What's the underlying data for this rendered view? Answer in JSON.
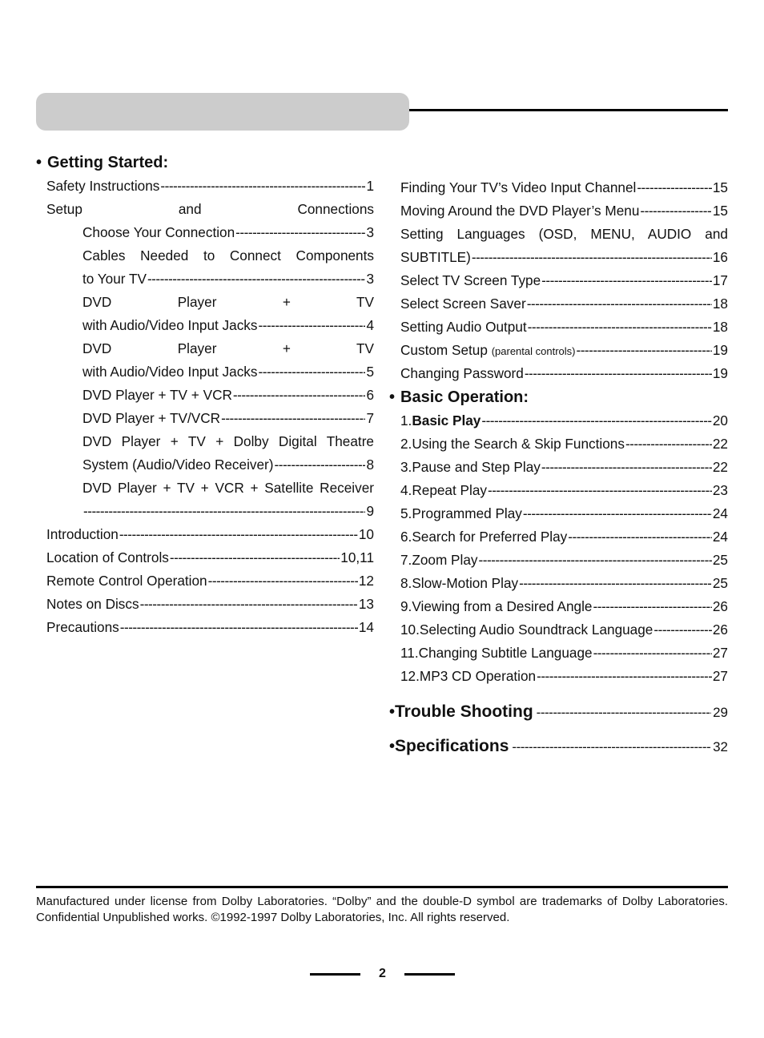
{
  "header": {
    "banner_colors": {
      "box": "#cccccc",
      "rule": "#000000"
    }
  },
  "left_column": {
    "section_title": "Getting Started:",
    "entries": [
      {
        "label": "Safety Instructions",
        "page": "1",
        "level": 0
      },
      {
        "label": "Setup and Connections",
        "page": "",
        "level": 0
      },
      {
        "label": "Choose  Your  Connection",
        "page": "3",
        "level": 1
      },
      {
        "label": "Cables Needed to Connect Components",
        "page": "",
        "level": 1
      },
      {
        "label": "to Your TV",
        "page": "3",
        "level": 1
      },
      {
        "label": "DVD Player + TV",
        "page": "",
        "level": 1
      },
      {
        "label": "with Audio/Video Input Jacks",
        "page": "4",
        "level": 1
      },
      {
        "label": "DVD Player + TV",
        "page": "",
        "level": 1
      },
      {
        "label": "with Audio/Video Input Jacks",
        "page": "5",
        "level": 1
      },
      {
        "label": "DVD Player + TV + VCR",
        "page": "6",
        "level": 1
      },
      {
        "label": "DVD Player + TV/VCR",
        "page": "7",
        "level": 1
      },
      {
        "label": "DVD Player + TV + Dolby Digital Theatre",
        "page": "",
        "level": 1
      },
      {
        "label": "System (Audio/Video Receiver)",
        "page": "8",
        "level": 1
      },
      {
        "label": "DVD Player + TV + VCR + Satellite Receiver",
        "page": "",
        "level": 1
      },
      {
        "label": "",
        "page": "9",
        "level": 1
      },
      {
        "label": "Introduction",
        "page": "10",
        "level": 0
      },
      {
        "label": "Location of Controls",
        "page": "10,11",
        "level": 0
      },
      {
        "label": "Remote Control Operation ",
        "page": "12",
        "level": 0
      },
      {
        "label": "Notes on Discs ",
        "page": "13",
        "level": 0
      },
      {
        "label": "Precautions",
        "page": "14",
        "level": 0
      }
    ]
  },
  "right_column": {
    "entries": [
      {
        "label": "Finding Your TV’s Video Input Channel",
        "page": "15"
      },
      {
        "label": "Moving Around the DVD Player’s Menu ",
        "page": "15"
      },
      {
        "label": "Setting Languages (OSD, MENU, AUDIO and",
        "page": ""
      },
      {
        "label": "SUBTITLE)",
        "page": "16"
      },
      {
        "label": "Select TV Screen Type ",
        "page": "17"
      },
      {
        "label": "Select Screen Saver ",
        "page": "18"
      },
      {
        "label": "Setting Audio Output ",
        "page": "18"
      },
      {
        "label": "Custom Setup",
        "note": "(parental controls)",
        "page": "19"
      },
      {
        "label": "Changing Password ",
        "page": "19"
      }
    ],
    "basic_operation": {
      "section_title": "Basic Operation:",
      "entries": [
        {
          "prefix": "1.",
          "label": "Basic Play",
          "page": "20",
          "bold": true
        },
        {
          "prefix": "2.",
          "label": "Using the Search & Skip Functions",
          "page": "22"
        },
        {
          "prefix": "3.",
          "label": "Pause and Step Play",
          "page": "22"
        },
        {
          "prefix": "4.",
          "label": "Repeat Play",
          "page": "23"
        },
        {
          "prefix": "5.",
          "label": "Programmed Play",
          "page": "24"
        },
        {
          "prefix": "6.",
          "label": "Search for Preferred Play",
          "page": "24"
        },
        {
          "prefix": "7.",
          "label": "Zoom Play",
          "page": "25"
        },
        {
          "prefix": "8.",
          "label": "Slow-Motion Play",
          "page": "25"
        },
        {
          "prefix": "9.",
          "label": "Viewing from a Desired Angle",
          "page": "26"
        },
        {
          "prefix": "10.",
          "label": "Selecting Audio Soundtrack Language",
          "page": "26"
        },
        {
          "prefix": "11.",
          "label": "Changing Subtitle Language",
          "page": "27"
        },
        {
          "prefix": "12.",
          "label": "MP3 CD Operation",
          "page": "27"
        }
      ]
    },
    "trouble_shooting": {
      "label": "Trouble Shooting",
      "page": "29"
    },
    "specifications": {
      "label": "Specifications",
      "page": "32"
    }
  },
  "footer": {
    "note": "Manufactured under license from Dolby Laboratories. “Dolby” and the double-D symbol are trademarks of Dolby Laboratories. Confidential Unpublished works. ©1992-1997 Dolby Laboratories, Inc. All rights reserved.",
    "page_number": "2"
  },
  "bullet_glyph": "•"
}
